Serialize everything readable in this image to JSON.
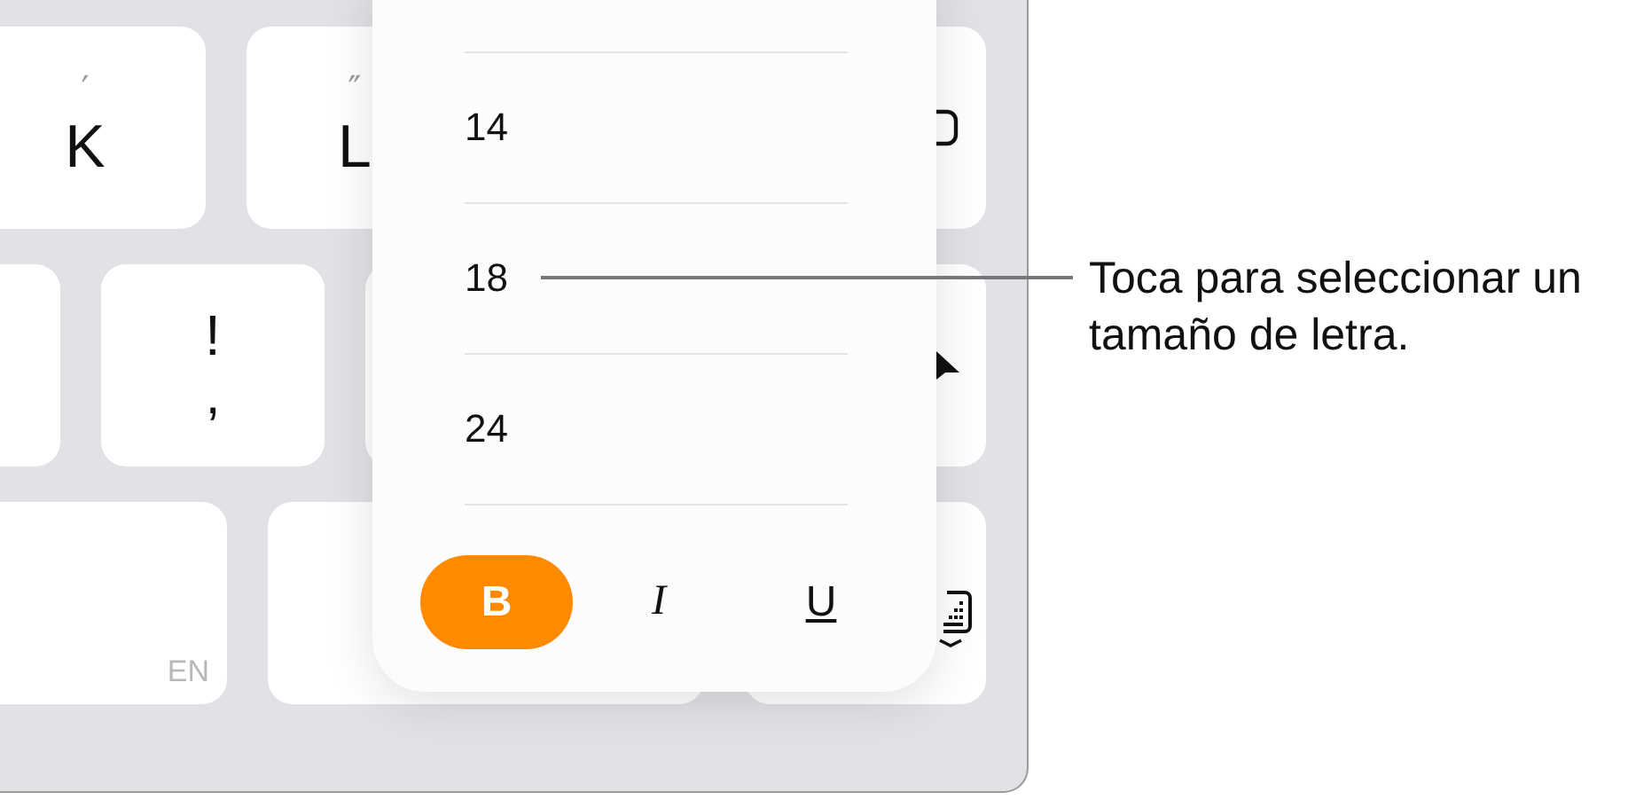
{
  "keyboard": {
    "rows": [
      {
        "keys": [
          {
            "kind": "letter",
            "top": "′",
            "main": "K"
          },
          {
            "kind": "letter",
            "top": "″",
            "main": "L"
          },
          {
            "kind": "tool"
          }
        ]
      },
      {
        "keys": [
          {
            "kind": "plain"
          },
          {
            "kind": "letter",
            "top": "!",
            "main": ","
          },
          {
            "kind": "plain"
          },
          {
            "kind": "tool"
          }
        ]
      },
      {
        "keys": [
          {
            "kind": "language",
            "corner": "EN"
          },
          {
            "kind": "plain"
          },
          {
            "kind": "tool"
          }
        ]
      }
    ]
  },
  "font_size_menu": {
    "sizes": [
      {
        "label": "14"
      },
      {
        "label": "18"
      },
      {
        "label": "24"
      }
    ],
    "styles": [
      {
        "kind": "bold",
        "label": "B",
        "selected": true
      },
      {
        "kind": "italic",
        "label": "I",
        "selected": false
      },
      {
        "kind": "underline",
        "label": "U",
        "selected": false
      }
    ]
  },
  "callout": {
    "text": "Toca para seleccionar un tamaño de letra."
  }
}
